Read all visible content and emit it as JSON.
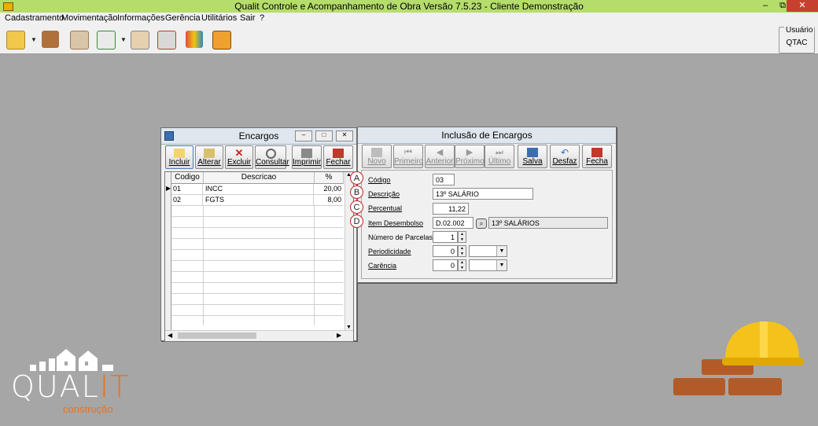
{
  "app": {
    "title": "Qualit Controle e Acompanhamento de Obra Versão 7.5.23 - Cliente Demonstração",
    "window_controls": {
      "minimize": "–",
      "restore": "⧉",
      "close": "✕"
    }
  },
  "menu": [
    "Cadastramento",
    "Movimentação",
    "Informações",
    "Gerência",
    "Utilitários",
    "Sair",
    "?"
  ],
  "toolbar": {
    "icons": [
      "new-folder-icon",
      "truck-icon",
      "calendar-icon",
      "spreadsheet-icon",
      "person-chart-icon",
      "calendar-clock-icon",
      "bar-chart-icon",
      "exit-door-icon"
    ],
    "user_label": "Usuário",
    "user_value": "QTAC"
  },
  "encargos": {
    "title": "Encargos",
    "buttons": [
      "Incluir",
      "Alterar",
      "Excluir",
      "Consultar",
      "Imprimir",
      "Fechar"
    ],
    "columns": [
      "Codigo",
      "Descricao",
      "%"
    ],
    "rows": [
      {
        "codigo": "01",
        "descricao": "INCC",
        "pct": "20,00"
      },
      {
        "codigo": "02",
        "descricao": "FGTS",
        "pct": "8,00"
      }
    ]
  },
  "inclusao": {
    "title": "Inclusão de Encargos",
    "buttons": [
      "Novo",
      "Primeiro",
      "Anterior",
      "Próximo",
      "Último",
      "Salva",
      "Desfaz",
      "Fecha"
    ],
    "labels": {
      "codigo": "Código",
      "descricao": "Descrição",
      "percentual": "Percentual",
      "item": "Item Desembolso",
      "parcelas": "Número de Parcelas",
      "periodicidade": "Periodicidade",
      "carencia": "Carência"
    },
    "values": {
      "codigo": "03",
      "descricao": "13º SALÁRIO",
      "percentual": "11,22",
      "item_code": "D.02.002",
      "item_desc": "13º SALÁRIOS",
      "parcelas": "1",
      "periodicidade": "0",
      "carencia": "0"
    },
    "markers": [
      "A",
      "B",
      "C",
      "D"
    ]
  },
  "logo": {
    "word1": "QUAL",
    "word2": "IT",
    "tagline": "construção"
  },
  "colors": {
    "titlebar": "#b5dd6b",
    "background": "#a6a6a6",
    "marker": "#c62020",
    "logo_orange": "#e8731f"
  }
}
